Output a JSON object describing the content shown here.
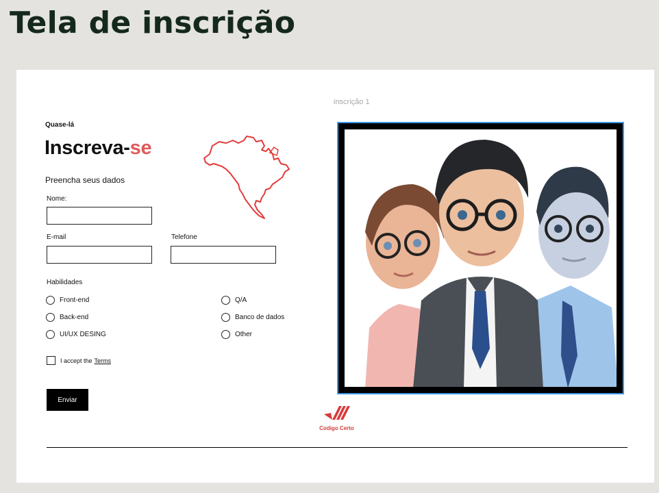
{
  "page": {
    "title": "Tela de inscrição"
  },
  "frame": {
    "label": "inscrição 1"
  },
  "form": {
    "eyebrow": "Quase-lá",
    "heading_main": "Inscreva-",
    "heading_accent": "se",
    "subheading": "Preencha seus dados",
    "name_label": "Nome:",
    "name_value": "",
    "email_label": "E-mail",
    "email_value": "",
    "phone_label": "Telefone",
    "phone_value": "",
    "skills_label": "Habilidades",
    "skills": [
      "Front-end",
      "Back-end",
      "UI/UX DESING",
      "Q/A",
      "Banco de dados",
      "Other"
    ],
    "accept_label": "I accept the",
    "terms_link": "Terms",
    "submit_label": "Enviar"
  },
  "logo": {
    "text": "Codigo Certo"
  },
  "colors": {
    "accent": "#e05a5a",
    "background": "#e4e3df",
    "image_border": "#3a98e8",
    "logo": "#d83a3a"
  },
  "icons": {
    "map": "north-america-map-outline",
    "logo": "codigo-certo-logo"
  }
}
